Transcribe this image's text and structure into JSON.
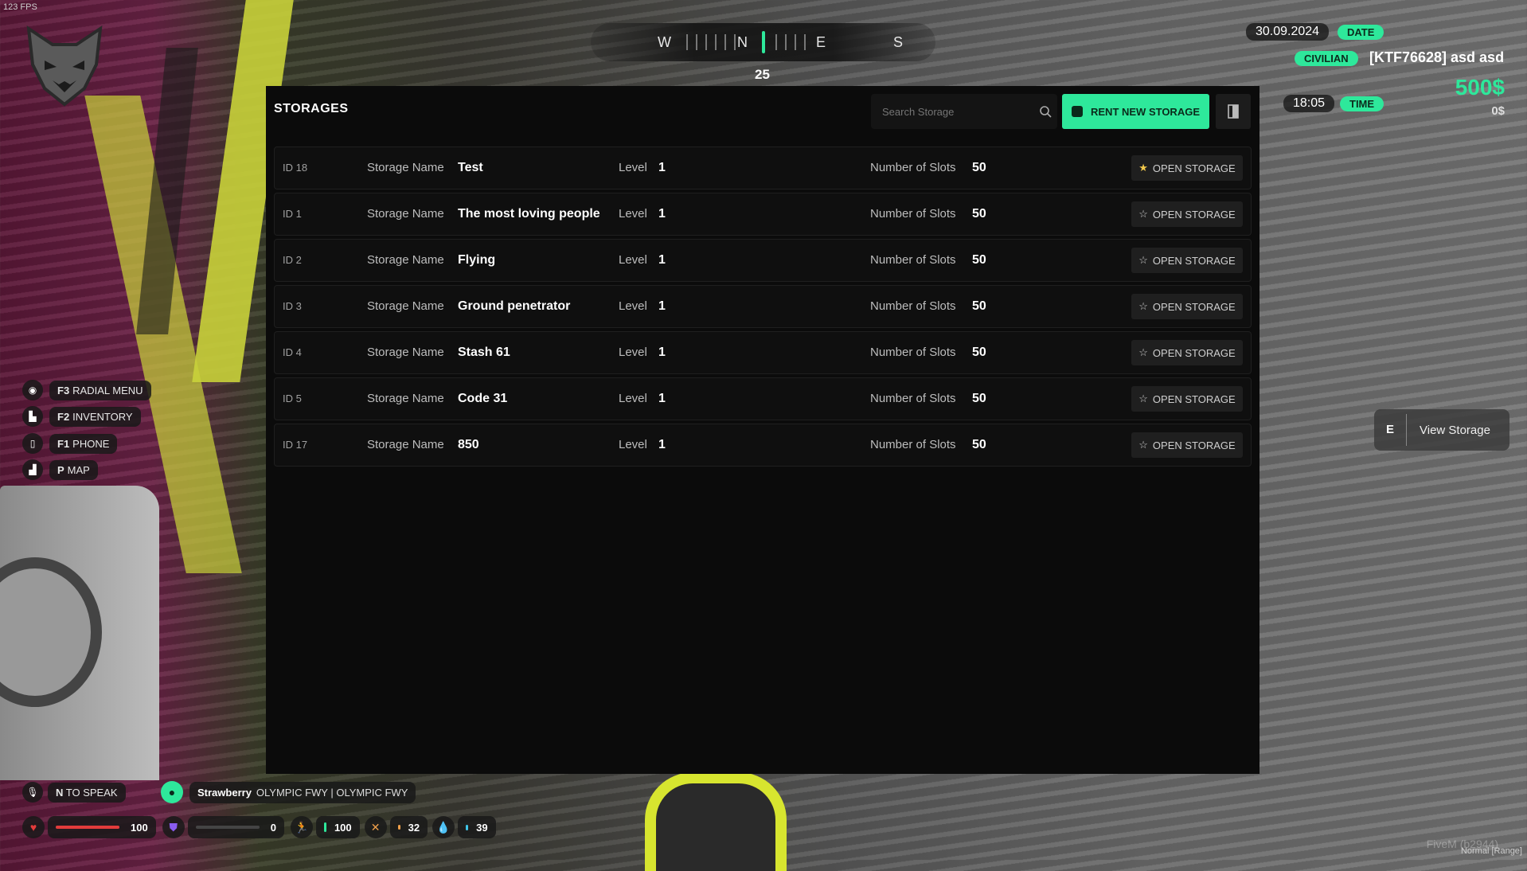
{
  "hud": {
    "fps": "123 FPS",
    "compass": {
      "west": "W",
      "north": "N",
      "east": "E",
      "south": "S",
      "heading": "25"
    },
    "date_value": "30.09.2024",
    "date_label": "DATE",
    "time_value": "18:05",
    "time_label": "TIME",
    "job": "CIVILIAN",
    "player_name": "[KTF76628] asd asd",
    "cash": "500$",
    "bank": "0$",
    "accent_color": "#2ee89b"
  },
  "key_hints": [
    {
      "key": "F3",
      "label": "RADIAL MENU",
      "icon": "radial-icon"
    },
    {
      "key": "F2",
      "label": "INVENTORY",
      "icon": "inventory-icon"
    },
    {
      "key": "F1",
      "label": "PHONE",
      "icon": "phone-icon"
    },
    {
      "key": "P",
      "label": "MAP",
      "icon": "map-icon"
    }
  ],
  "panel": {
    "title": "STORAGES",
    "search_placeholder": "Search Storage",
    "rent_label": "RENT NEW STORAGE",
    "name_label": "Storage Name",
    "level_label": "Level",
    "slots_label": "Number of Slots",
    "open_label": "OPEN STORAGE",
    "rows": [
      {
        "id": "ID 18",
        "name": "Test",
        "level": "1",
        "slots": "50",
        "favorite": true
      },
      {
        "id": "ID 1",
        "name": "The most loving people",
        "level": "1",
        "slots": "50",
        "favorite": false
      },
      {
        "id": "ID 2",
        "name": "Flying",
        "level": "1",
        "slots": "50",
        "favorite": false
      },
      {
        "id": "ID 3",
        "name": "Ground penetrator",
        "level": "1",
        "slots": "50",
        "favorite": false
      },
      {
        "id": "ID 4",
        "name": "Stash 61",
        "level": "1",
        "slots": "50",
        "favorite": false
      },
      {
        "id": "ID 5",
        "name": "Code 31",
        "level": "1",
        "slots": "50",
        "favorite": false
      },
      {
        "id": "ID 17",
        "name": "850",
        "level": "1",
        "slots": "50",
        "favorite": false
      }
    ]
  },
  "prompt": {
    "key": "E",
    "label": "View Storage"
  },
  "voice": {
    "key": "N",
    "label": "TO SPEAK"
  },
  "location": {
    "area": "Strawberry",
    "street": "OLYMPIC FWY | OLYMPIC FWY"
  },
  "stats": {
    "health": "100",
    "armor": "0",
    "stamina": "100",
    "hunger": "32",
    "thirst": "39"
  },
  "watermark": {
    "brand": "FiveM (b2944)",
    "mode": "Normal [Range]"
  }
}
